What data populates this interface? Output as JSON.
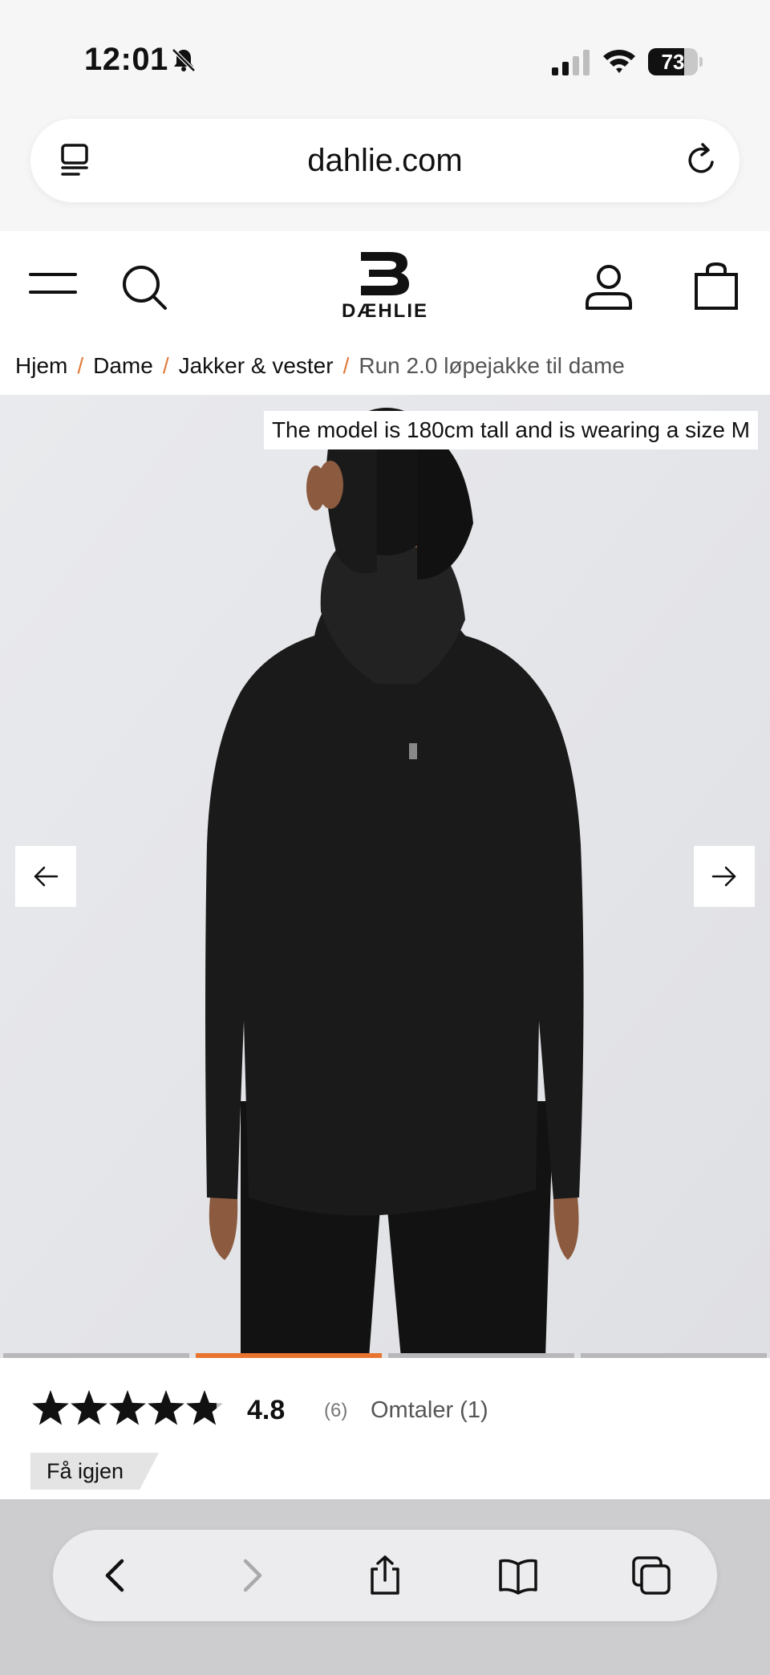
{
  "status_bar": {
    "time": "12:01",
    "battery": "73",
    "battery_level": 0.73
  },
  "browser": {
    "url": "dahlie.com"
  },
  "header": {
    "logo_text": "DÆHLIE"
  },
  "breadcrumb": {
    "items": [
      "Hjem",
      "Dame",
      "Jakker & vester",
      "Run 2.0 løpejakke til dame"
    ],
    "separator": "/"
  },
  "gallery": {
    "model_note": "The model is 180cm tall and is wearing a size M",
    "image_count": 4,
    "active_index": 1
  },
  "rating": {
    "value": "4.8",
    "count": "(6)",
    "reviews_link": "Omtaler (1)",
    "stars_filled": 4.8
  },
  "badge": {
    "restock_label": "Få igjen"
  },
  "colors": {
    "accent": "#e8742f",
    "gallery_bg": "#e6e7ea",
    "badge_bg": "#e4e4e4"
  }
}
